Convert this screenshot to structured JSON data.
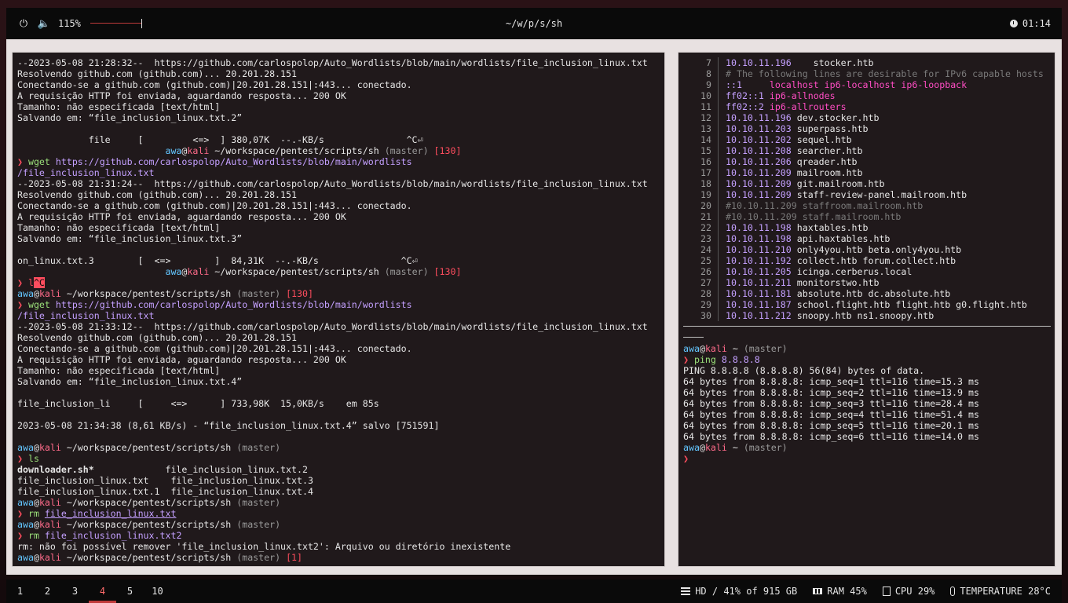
{
  "topbar": {
    "power_icon": "power-icon",
    "volume_icon": "speaker-icon",
    "volume_value": "115%",
    "volume_level": 1.0,
    "title": "~/w/p/s/sh",
    "clock_icon": "clock-icon",
    "time": "01:14"
  },
  "left_terminal": {
    "lines": [
      [
        {
          "t": "--2023-05-08 21:28:32--  https://github.com/carlospolop/Auto_Wordlists/blob/main/wordlists/file_inclusion_linux.txt"
        }
      ],
      [
        {
          "t": "Resolvendo github.com (github.com)... 20.201.28.151"
        }
      ],
      [
        {
          "t": "Conectando-se a github.com (github.com)|20.201.28.151|:443... conectado."
        }
      ],
      [
        {
          "t": "A requisição HTTP foi enviada, aguardando resposta... 200 OK"
        }
      ],
      [
        {
          "t": "Tamanho: não especificada [text/html]"
        }
      ],
      [
        {
          "t": "Salvando em: “file_inclusion_linux.txt.2”"
        }
      ],
      [
        {
          "t": ""
        }
      ],
      [
        {
          "t": "             file     [         <=>  ] 380,07K  --.-KB/s               ^C⏎"
        }
      ],
      [
        {
          "t": "                           "
        },
        {
          "t": "awa",
          "c": "user"
        },
        {
          "t": "@"
        },
        {
          "t": "kali",
          "c": "host"
        },
        {
          "t": " ~/workspace/pentest/scripts/sh "
        },
        {
          "t": "(master)",
          "c": "git"
        },
        {
          "t": " "
        },
        {
          "t": "[130]",
          "c": "err"
        }
      ],
      [
        {
          "t": "❯ ",
          "c": "arrow"
        },
        {
          "t": "wget",
          "c": "cmd"
        },
        {
          "t": " "
        },
        {
          "t": "https://github.com/carlospolop/Auto_Wordlists/blob/main/wordlists",
          "c": "url"
        }
      ],
      [
        {
          "t": "/file_inclusion_linux.txt",
          "c": "url"
        }
      ],
      [
        {
          "t": "--2023-05-08 21:31:24--  https://github.com/carlospolop/Auto_Wordlists/blob/main/wordlists/file_inclusion_linux.txt"
        }
      ],
      [
        {
          "t": "Resolvendo github.com (github.com)... 20.201.28.151"
        }
      ],
      [
        {
          "t": "Conectando-se a github.com (github.com)|20.201.28.151|:443... conectado."
        }
      ],
      [
        {
          "t": "A requisição HTTP foi enviada, aguardando resposta... 200 OK"
        }
      ],
      [
        {
          "t": "Tamanho: não especificada [text/html]"
        }
      ],
      [
        {
          "t": "Salvando em: “file_inclusion_linux.txt.3”"
        }
      ],
      [
        {
          "t": ""
        }
      ],
      [
        {
          "t": "on_linux.txt.3        [  <=>        ]  84,31K  --.-KB/s               ^C⏎"
        }
      ],
      [
        {
          "t": "                           "
        },
        {
          "t": "awa",
          "c": "user"
        },
        {
          "t": "@"
        },
        {
          "t": "kali",
          "c": "host"
        },
        {
          "t": " ~/workspace/pentest/scripts/sh "
        },
        {
          "t": "(master)",
          "c": "git"
        },
        {
          "t": " "
        },
        {
          "t": "[130]",
          "c": "err"
        }
      ],
      [
        {
          "t": "❯ ",
          "c": "arrow"
        },
        {
          "t": "l",
          "c": "err"
        },
        {
          "t": "^C",
          "c": "hl"
        }
      ],
      [
        {
          "t": "awa",
          "c": "user"
        },
        {
          "t": "@"
        },
        {
          "t": "kali",
          "c": "host"
        },
        {
          "t": " ~/workspace/pentest/scripts/sh "
        },
        {
          "t": "(master)",
          "c": "git"
        },
        {
          "t": " "
        },
        {
          "t": "[130]",
          "c": "err"
        }
      ],
      [
        {
          "t": "❯ ",
          "c": "arrow"
        },
        {
          "t": "wget",
          "c": "cmd"
        },
        {
          "t": " "
        },
        {
          "t": "https://github.com/carlospolop/Auto_Wordlists/blob/main/wordlists",
          "c": "url"
        }
      ],
      [
        {
          "t": "/file_inclusion_linux.txt",
          "c": "url"
        }
      ],
      [
        {
          "t": "--2023-05-08 21:33:12--  https://github.com/carlospolop/Auto_Wordlists/blob/main/wordlists/file_inclusion_linux.txt"
        }
      ],
      [
        {
          "t": "Resolvendo github.com (github.com)... 20.201.28.151"
        }
      ],
      [
        {
          "t": "Conectando-se a github.com (github.com)|20.201.28.151|:443... conectado."
        }
      ],
      [
        {
          "t": "A requisição HTTP foi enviada, aguardando resposta... 200 OK"
        }
      ],
      [
        {
          "t": "Tamanho: não especificada [text/html]"
        }
      ],
      [
        {
          "t": "Salvando em: “file_inclusion_linux.txt.4”"
        }
      ],
      [
        {
          "t": ""
        }
      ],
      [
        {
          "t": "file_inclusion_li     [     <=>      ] 733,98K  15,0KB/s    em 85s"
        }
      ],
      [
        {
          "t": ""
        }
      ],
      [
        {
          "t": "2023-05-08 21:34:38 (8,61 KB/s) - “file_inclusion_linux.txt.4” salvo [751591]"
        }
      ],
      [
        {
          "t": ""
        }
      ],
      [
        {
          "t": "awa",
          "c": "user"
        },
        {
          "t": "@"
        },
        {
          "t": "kali",
          "c": "host"
        },
        {
          "t": " ~/workspace/pentest/scripts/sh "
        },
        {
          "t": "(master)",
          "c": "git"
        }
      ],
      [
        {
          "t": "❯ ",
          "c": "arrow"
        },
        {
          "t": "ls",
          "c": "cmd"
        }
      ],
      [
        {
          "t": "downloader.sh*",
          "c": "bold"
        },
        {
          "t": "             file_inclusion_linux.txt.2"
        }
      ],
      [
        {
          "t": "file_inclusion_linux.txt    file_inclusion_linux.txt.3"
        }
      ],
      [
        {
          "t": "file_inclusion_linux.txt.1  file_inclusion_linux.txt.4"
        }
      ],
      [
        {
          "t": "awa",
          "c": "user"
        },
        {
          "t": "@"
        },
        {
          "t": "kali",
          "c": "host"
        },
        {
          "t": " ~/workspace/pentest/scripts/sh "
        },
        {
          "t": "(master)",
          "c": "git"
        }
      ],
      [
        {
          "t": "❯ ",
          "c": "arrow"
        },
        {
          "t": "rm",
          "c": "cmd"
        },
        {
          "t": " "
        },
        {
          "t": "file_inclusion_linux.txt",
          "c": "url under"
        }
      ],
      [
        {
          "t": "awa",
          "c": "user"
        },
        {
          "t": "@"
        },
        {
          "t": "kali",
          "c": "host"
        },
        {
          "t": " ~/workspace/pentest/scripts/sh "
        },
        {
          "t": "(master)",
          "c": "git"
        }
      ],
      [
        {
          "t": "❯ ",
          "c": "arrow"
        },
        {
          "t": "rm",
          "c": "cmd"
        },
        {
          "t": " "
        },
        {
          "t": "file_inclusion_linux.txt2",
          "c": "url"
        }
      ],
      [
        {
          "t": "rm: não foi possível remover 'file_inclusion_linux.txt2': Arquivo ou diretório inexistente"
        }
      ],
      [
        {
          "t": "awa",
          "c": "user"
        },
        {
          "t": "@"
        },
        {
          "t": "kali",
          "c": "host"
        },
        {
          "t": " ~/workspace/pentest/scripts/sh "
        },
        {
          "t": "(master)",
          "c": "git"
        },
        {
          "t": " "
        },
        {
          "t": "[1]",
          "c": "err"
        }
      ]
    ]
  },
  "hosts_file": {
    "rows": [
      {
        "n": "7",
        "parts": [
          {
            "t": "10.10.11.196",
            "c": "ip"
          },
          {
            "t": "    stocker.htb"
          }
        ]
      },
      {
        "n": "8",
        "parts": [
          {
            "t": "# The following lines are desirable for IPv6 capable hosts",
            "c": "cmt"
          }
        ]
      },
      {
        "n": "9",
        "parts": [
          {
            "t": "::1",
            "c": "ip"
          },
          {
            "t": "     "
          },
          {
            "t": "localhost ip6-localhost ip6-loopback",
            "c": "pink"
          }
        ]
      },
      {
        "n": "10",
        "parts": [
          {
            "t": "ff02::1",
            "c": "ip"
          },
          {
            "t": " "
          },
          {
            "t": "ip6-allnodes",
            "c": "pink"
          }
        ]
      },
      {
        "n": "11",
        "parts": [
          {
            "t": "ff02::2",
            "c": "ip"
          },
          {
            "t": " "
          },
          {
            "t": "ip6-allrouters",
            "c": "pink"
          }
        ]
      },
      {
        "n": "12",
        "parts": [
          {
            "t": "10.10.11.196",
            "c": "ip"
          },
          {
            "t": " dev.stocker.htb"
          }
        ]
      },
      {
        "n": "13",
        "parts": [
          {
            "t": "10.10.11.203",
            "c": "ip"
          },
          {
            "t": " superpass.htb"
          }
        ]
      },
      {
        "n": "14",
        "parts": [
          {
            "t": "10.10.11.202",
            "c": "ip"
          },
          {
            "t": " sequel.htb"
          }
        ]
      },
      {
        "n": "15",
        "parts": [
          {
            "t": "10.10.11.208",
            "c": "ip"
          },
          {
            "t": " searcher.htb"
          }
        ]
      },
      {
        "n": "16",
        "parts": [
          {
            "t": "10.10.11.206",
            "c": "ip"
          },
          {
            "t": " qreader.htb"
          }
        ]
      },
      {
        "n": "17",
        "parts": [
          {
            "t": "10.10.11.209",
            "c": "ip"
          },
          {
            "t": " mailroom.htb"
          }
        ]
      },
      {
        "n": "18",
        "parts": [
          {
            "t": "10.10.11.209",
            "c": "ip"
          },
          {
            "t": " git.mailroom.htb"
          }
        ]
      },
      {
        "n": "19",
        "parts": [
          {
            "t": "10.10.11.209",
            "c": "ip"
          },
          {
            "t": " staff-review-panel.mailroom.htb"
          }
        ]
      },
      {
        "n": "20",
        "parts": [
          {
            "t": "#10.10.11.209 staffroom.mailroom.htb",
            "c": "cmt"
          }
        ]
      },
      {
        "n": "21",
        "parts": [
          {
            "t": "#10.10.11.209 staff.mailroom.htb",
            "c": "cmt"
          }
        ]
      },
      {
        "n": "22",
        "parts": [
          {
            "t": "10.10.11.198",
            "c": "ip"
          },
          {
            "t": " haxtables.htb"
          }
        ]
      },
      {
        "n": "23",
        "parts": [
          {
            "t": "10.10.11.198",
            "c": "ip"
          },
          {
            "t": " api.haxtables.htb"
          }
        ]
      },
      {
        "n": "24",
        "parts": [
          {
            "t": "10.10.11.210",
            "c": "ip"
          },
          {
            "t": " only4you.htb beta.only4you.htb"
          }
        ]
      },
      {
        "n": "25",
        "parts": [
          {
            "t": "10.10.11.192",
            "c": "ip"
          },
          {
            "t": " collect.htb forum.collect.htb"
          }
        ]
      },
      {
        "n": "26",
        "parts": [
          {
            "t": "10.10.11.205",
            "c": "ip"
          },
          {
            "t": " icinga.cerberus.local"
          }
        ]
      },
      {
        "n": "27",
        "parts": [
          {
            "t": "10.10.11.211",
            "c": "ip"
          },
          {
            "t": " monitorstwo.htb"
          }
        ]
      },
      {
        "n": "28",
        "parts": [
          {
            "t": "10.10.11.181",
            "c": "ip"
          },
          {
            "t": " absolute.htb dc.absolute.htb"
          }
        ]
      },
      {
        "n": "29",
        "parts": [
          {
            "t": "10.10.11.187",
            "c": "ip"
          },
          {
            "t": " school.flight.htb flight.htb g0.flight.htb"
          }
        ]
      },
      {
        "n": "30",
        "parts": [
          {
            "t": "10.10.11.212",
            "c": "ip"
          },
          {
            "t": " snoopy.htb ns1.snoopy.htb"
          }
        ]
      }
    ]
  },
  "ping_terminal": {
    "lines": [
      [
        {
          "t": "awa",
          "c": "user"
        },
        {
          "t": "@"
        },
        {
          "t": "kali",
          "c": "host"
        },
        {
          "t": " ~ "
        },
        {
          "t": "(master)",
          "c": "git"
        }
      ],
      [
        {
          "t": "❯ ",
          "c": "arrow"
        },
        {
          "t": "ping",
          "c": "cmd"
        },
        {
          "t": " "
        },
        {
          "t": "8.8.8.8",
          "c": "url"
        }
      ],
      [
        {
          "t": "PING 8.8.8.8 (8.8.8.8) 56(84) bytes of data."
        }
      ],
      [
        {
          "t": "64 bytes from 8.8.8.8: icmp_seq=1 ttl=116 time=15.3 ms"
        }
      ],
      [
        {
          "t": "64 bytes from 8.8.8.8: icmp_seq=2 ttl=116 time=13.9 ms"
        }
      ],
      [
        {
          "t": "64 bytes from 8.8.8.8: icmp_seq=3 ttl=116 time=28.4 ms"
        }
      ],
      [
        {
          "t": "64 bytes from 8.8.8.8: icmp_seq=4 ttl=116 time=51.4 ms"
        }
      ],
      [
        {
          "t": "64 bytes from 8.8.8.8: icmp_seq=5 ttl=116 time=20.1 ms"
        }
      ],
      [
        {
          "t": "64 bytes from 8.8.8.8: icmp_seq=6 ttl=116 time=14.0 ms"
        }
      ],
      [
        {
          "t": "awa",
          "c": "user"
        },
        {
          "t": "@"
        },
        {
          "t": "kali",
          "c": "host"
        },
        {
          "t": " ~ "
        },
        {
          "t": "(master)",
          "c": "git"
        }
      ],
      [
        {
          "t": "❯",
          "c": "arrow"
        }
      ]
    ]
  },
  "bottombar": {
    "workspaces": [
      "1",
      "2",
      "3",
      "4",
      "5",
      "10"
    ],
    "active_workspace": "4",
    "disk_icon": "hard-drive-icon",
    "disk": "HD / 41% of 915 GB",
    "ram_icon": "memory-icon",
    "ram": "RAM 45%",
    "cpu_icon": "cpu-icon",
    "cpu": "CPU 29%",
    "temp_icon": "thermometer-icon",
    "temperature": "TEMPERATURE 28°C"
  },
  "colors": {
    "accent_red": "#c03a3a",
    "user": "#63c6ff",
    "host": "#ff6b8a",
    "ip": "#c4a0ff",
    "command": "#9be07a"
  }
}
